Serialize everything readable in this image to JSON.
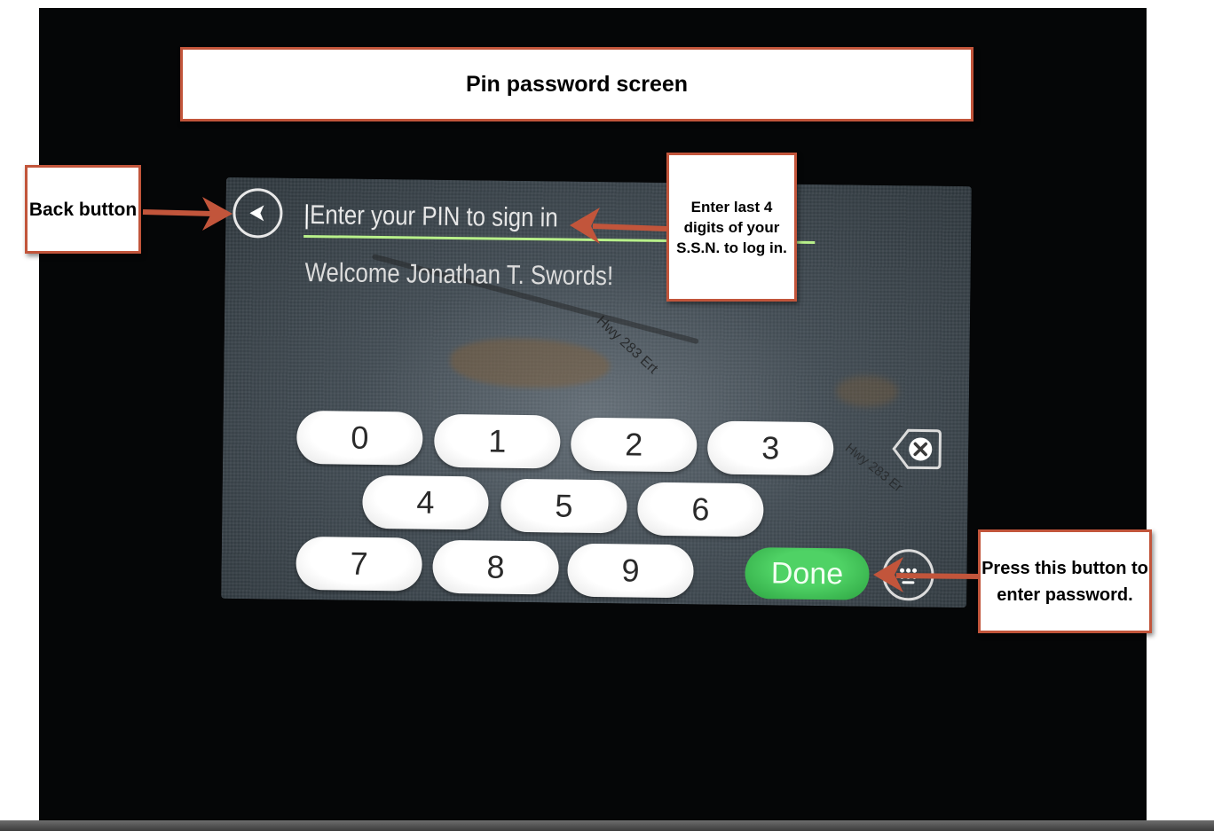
{
  "callouts": {
    "title": "Pin password screen",
    "back": "Back button",
    "ssn": "Enter last 4 digits of your S.S.N. to log in.",
    "done": "Press this button to enter password."
  },
  "screen": {
    "pin_placeholder": "Enter your PIN to sign in",
    "welcome": "Welcome Jonathan T.  Swords!",
    "road_label": "Hwy 283 Ert",
    "road_label_2": "Hwy 283 Er",
    "keys_row1": [
      "0",
      "1",
      "2",
      "3"
    ],
    "keys_row2": [
      "4",
      "5",
      "6"
    ],
    "keys_row3": [
      "7",
      "8",
      "9"
    ],
    "done_label": "Done"
  },
  "icons": {
    "back": "back-arrow-icon",
    "clear": "backspace-clear-icon",
    "keyboard": "keyboard-icon"
  },
  "colors": {
    "callout_border": "#c2553b",
    "arrow": "#c2553b",
    "input_underline": "#b8f08a",
    "done_green": "#3fbf55"
  }
}
